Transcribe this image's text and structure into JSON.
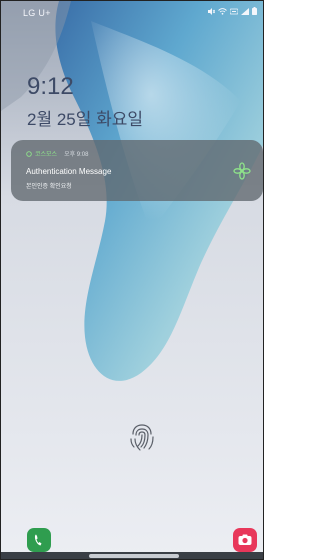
{
  "status_bar": {
    "carrier": "LG U+",
    "icons": [
      "mute-icon",
      "wifi-icon",
      "lte-icon",
      "signal-icon",
      "battery-icon"
    ]
  },
  "lockscreen": {
    "time": "9:12",
    "date": "2월 25일 화요일"
  },
  "notification": {
    "app_name": "코스모스",
    "time": "오후 9:08",
    "title": "Authentication Message",
    "body": "본인인증 확인요청",
    "app_icon": "clover-icon"
  },
  "shortcuts": {
    "left": "phone-icon",
    "right": "camera-icon"
  },
  "colors": {
    "clock": "#3d4a66",
    "notification_bg": "#60686e",
    "app_accent": "#8fe38a",
    "phone": "#2f9d4f",
    "camera": "#e8375a"
  }
}
